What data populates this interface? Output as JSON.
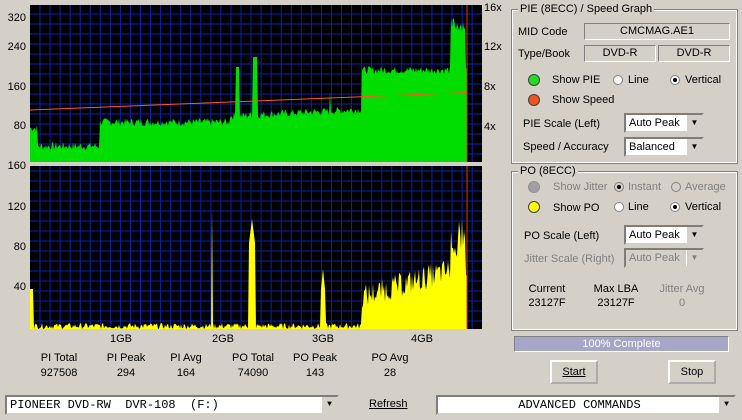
{
  "pie_graph": {
    "y_left": [
      "320",
      "240",
      "160",
      "80"
    ],
    "y_right": [
      "16x",
      "12x",
      "8x",
      "4x"
    ]
  },
  "po_graph": {
    "y_left": [
      "160",
      "120",
      "80",
      "40"
    ]
  },
  "x_axis": [
    "1GB",
    "2GB",
    "3GB",
    "4GB"
  ],
  "stats": {
    "pi_total_label": "PI Total",
    "pi_total": "927508",
    "pi_peak_label": "PI Peak",
    "pi_peak": "294",
    "pi_avg_label": "PI Avg",
    "pi_avg": "164",
    "po_total_label": "PO Total",
    "po_total": "74090",
    "po_peak_label": "PO Peak",
    "po_peak": "143",
    "po_avg_label": "PO Avg",
    "po_avg": "28"
  },
  "pie_panel": {
    "title": "PIE (8ECC) / Speed Graph",
    "mid_label": "MID Code",
    "mid_value": "CMCMAG.AE1",
    "type_label": "Type/Book",
    "type_value": "DVD-R",
    "book_value": "DVD-R",
    "show_pie": "Show PIE",
    "line": "Line",
    "vertical": "Vertical",
    "show_speed": "Show Speed",
    "scale_label": "PIE Scale (Left)",
    "scale_value": "Auto Peak",
    "speed_label": "Speed / Accuracy",
    "speed_value": "Balanced",
    "pie_color": "#00dd00",
    "speed_color": "#ff5522"
  },
  "po_panel": {
    "title": "PO (8ECC)",
    "show_jitter": "Show Jitter",
    "instant": "Instant",
    "average": "Average",
    "show_po": "Show PO",
    "line": "Line",
    "vertical": "Vertical",
    "scale_label": "PO Scale (Left)",
    "scale_value": "Auto Peak",
    "jitter_label": "Jitter Scale (Right)",
    "jitter_value": "Auto Peak",
    "current_label": "Current",
    "current_value": "23127F",
    "maxlba_label": "Max LBA",
    "maxlba_value": "23127F",
    "jitter_avg_label": "Jitter Avg",
    "jitter_avg_value": "0",
    "po_color": "#ffff00"
  },
  "progress": {
    "text": "100% Complete",
    "fraction": 1.0
  },
  "buttons": {
    "start": "Start",
    "stop": "Stop",
    "refresh": "Refresh"
  },
  "drive": "PIONEER DVD-RW  DVR-108  (F:)",
  "commands": "ADVANCED COMMANDS"
}
